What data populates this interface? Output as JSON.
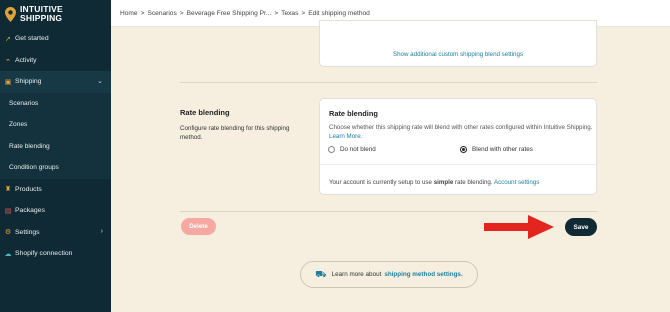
{
  "brand": {
    "line1": "INTUITIVE",
    "line2": "SHIPPING",
    "accent": "#e2a23a",
    "sidebar_bg": "#0f2a35"
  },
  "breadcrumb": {
    "items": [
      "Home",
      "Scenarios",
      "Beverage Free Shipping Pr...",
      "Texas",
      "Edit shipping method"
    ],
    "separator": ">"
  },
  "sidebar": {
    "items": [
      {
        "label": "Get started",
        "icon": "rocket-icon"
      },
      {
        "label": "Activity",
        "icon": "activity-icon"
      },
      {
        "label": "Shipping",
        "icon": "truck-icon"
      },
      {
        "label": "Products",
        "icon": "shirt-icon"
      },
      {
        "label": "Packages",
        "icon": "package-icon"
      },
      {
        "label": "Settings",
        "icon": "gear-icon"
      },
      {
        "label": "Shopify connection",
        "icon": "cloud-icon"
      }
    ],
    "subitems": [
      "Scenarios",
      "Zones",
      "Rate blending",
      "Condition groups"
    ]
  },
  "custom_blend_link": "Show additional custom shipping blend settings",
  "rate_section": {
    "title": "Rate blending",
    "description": "Configure rate blending for this shipping method.",
    "card_title": "Rate blending",
    "card_desc": "Choose whether this shipping rate will blend with other rates configured within Intuitive Shipping.",
    "learn_more": "Learn More.",
    "option_no": "Do not blend",
    "option_yes": "Blend with other rates",
    "selected": "Blend with other rates",
    "footer_prefix": "Your account is currently setup to use",
    "footer_bold": "simple",
    "footer_suffix": "rate blending.",
    "footer_link": "Account settings"
  },
  "actions": {
    "delete": "Delete",
    "save": "Save"
  },
  "learn_more_banner": {
    "prefix": "Learn more about",
    "link": "shipping method settings."
  },
  "colors": {
    "delete_bg": "#f7a8a0",
    "save_bg": "#0f2a35",
    "arrow": "#e3241f",
    "link": "#1d7ea0"
  }
}
